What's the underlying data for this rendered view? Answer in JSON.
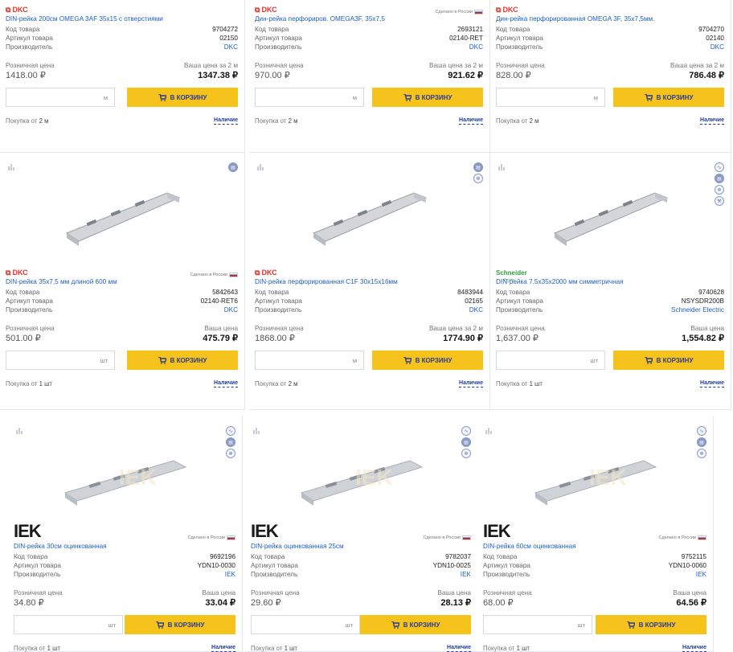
{
  "cards": [
    {
      "brand": "DKC",
      "made": "",
      "title": "DIN-рейка 200см OMEGA 3AF 35x15 с отверстиями",
      "code_label": "Код товара",
      "code": "9704272",
      "art_label": "Артикул товара",
      "art": "02150",
      "mfr_label": "Производитель",
      "mfr": "DKC",
      "retail_label": "Розничная цена",
      "your_label": "Ваша цена за 2 м",
      "retail": "1418.00 ₽",
      "your": "1347.38 ₽",
      "unit": "м",
      "cart": "В КОРЗИНУ",
      "min_label": "Покупка от",
      "min": "2 м",
      "avail": "Наличие"
    },
    {
      "brand": "DKC",
      "made": "Сделано в России",
      "title": "Дин-рейка перфориров. OMEGA3F, 35x7,5",
      "code_label": "Код товара",
      "code": "2693121",
      "art_label": "Артикул товара",
      "art": "02140-RET",
      "mfr_label": "Производитель",
      "mfr": "DKC",
      "retail_label": "Розничная цена",
      "your_label": "Ваша цена за 2 м",
      "retail": "970.00 ₽",
      "your": "921.62 ₽",
      "unit": "м",
      "cart": "В КОРЗИНУ",
      "min_label": "Покупка от",
      "min": "2 м",
      "avail": "Наличие"
    },
    {
      "brand": "DKC",
      "made": "",
      "title": "Дин-рейка перфорированная OMEGA 3F, 35x7,5мм.",
      "code_label": "Код товара",
      "code": "9704270",
      "art_label": "Артикул товара",
      "art": "02140",
      "mfr_label": "Производитель",
      "mfr": "DKC",
      "retail_label": "Розничная цена",
      "your_label": "Ваша цена за 2 м",
      "retail": "828.00 ₽",
      "your": "786.48 ₽",
      "unit": "м",
      "cart": "В КОРЗИНУ",
      "min_label": "Покупка от",
      "min": "2 м",
      "avail": "Наличие"
    },
    {
      "brand": "DKC",
      "made": "Сделано в России",
      "title": "DIN-рейка 35x7,5 мм длиной 600 мм",
      "code_label": "Код товара",
      "code": "5842643",
      "art_label": "Артикул товара",
      "art": "02140-RET6",
      "mfr_label": "Производитель",
      "mfr": "DKC",
      "retail_label": "Розничная цена",
      "your_label": "Ваша цена",
      "retail": "501.00 ₽",
      "your": "475.79 ₽",
      "unit": "шт",
      "cart": "В КОРЗИНУ",
      "min_label": "Покупка от",
      "min": "1 шт",
      "avail": "Наличие"
    },
    {
      "brand": "DKC",
      "made": "",
      "title": "DIN-рейка перфорированная C1F 30x15x16мм",
      "code_label": "Код товара",
      "code": "8483944",
      "art_label": "Артикул товара",
      "art": "02165",
      "mfr_label": "Производитель",
      "mfr": "DKC",
      "retail_label": "Розничная цена",
      "your_label": "Ваша цена за 2 м",
      "retail": "1868.00 ₽",
      "your": "1774.90 ₽",
      "unit": "м",
      "cart": "В КОРЗИНУ",
      "min_label": "Покупка от",
      "min": "2 м",
      "avail": "Наличие"
    },
    {
      "brand": "Schneider",
      "made": "",
      "title": "DIN-рейка 7.5x35x2000 мм симметричная",
      "code_label": "Код товара",
      "code": "9740628",
      "art_label": "Артикул товара",
      "art": "NSYSDR200B",
      "mfr_label": "Производитель",
      "mfr": "Schneider Electric",
      "retail_label": "Розничная цена",
      "your_label": "Ваша цена",
      "retail": "1,637.00 ₽",
      "your": "1,554.82 ₽",
      "unit": "шт",
      "cart": "В КОРЗИНУ",
      "min_label": "Покупка от",
      "min": "1 шт",
      "avail": "Наличие"
    },
    {
      "brand": "IEK",
      "made": "Сделано в России",
      "title": "DIN-рейка 30см оцинкованная",
      "code_label": "Код товара",
      "code": "9692196",
      "art_label": "Артикул товара",
      "art": "YDN10-0030",
      "mfr_label": "Производитель",
      "mfr": "IEK",
      "retail_label": "Розничная цена",
      "your_label": "Ваша цена",
      "retail": "34.80 ₽",
      "your": "33.04 ₽",
      "unit": "шт",
      "cart": "В КОРЗИНУ",
      "min_label": "Покупка от",
      "min": "1 шт",
      "avail": "Наличие"
    },
    {
      "brand": "IEK",
      "made": "Сделано в России",
      "title": "DIN-рейка оцинкованная 25см",
      "code_label": "Код товара",
      "code": "9782037",
      "art_label": "Артикул товара",
      "art": "YDN10-0025",
      "mfr_label": "Производитель",
      "mfr": "IEK",
      "retail_label": "Розничная цена",
      "your_label": "Ваша цена",
      "retail": "29.60 ₽",
      "your": "28.13 ₽",
      "unit": "шт",
      "cart": "В КОРЗИНУ",
      "min_label": "Покупка от",
      "min": "1 шт",
      "avail": "Наличие"
    },
    {
      "brand": "IEK",
      "made": "Сделано в России",
      "title": "DIN-рейка 60см оцинкованная",
      "code_label": "Код товара",
      "code": "9752115",
      "art_label": "Артикул товара",
      "art": "YDN10-0060",
      "mfr_label": "Производитель",
      "mfr": "IEK",
      "retail_label": "Розничная цена",
      "your_label": "Ваша цена",
      "retail": "68.00 ₽",
      "your": "64.56 ₽",
      "unit": "шт",
      "cart": "В КОРЗИНУ",
      "min_label": "Покупка от",
      "min": "1 шт",
      "avail": "Наличие"
    }
  ],
  "icons": {
    "card_chart": "bar-chart-icon",
    "doc": "document-icon",
    "gear": "gear-icon",
    "curve": "characteristic-curve-icon",
    "wrench": "wrench-icon",
    "cart": "cart-icon"
  },
  "colors": {
    "accent_yellow": "#f6c21c",
    "link_blue": "#1f5fbf",
    "dkc_red": "#e0342a",
    "schneider_green": "#2f9e3e"
  }
}
